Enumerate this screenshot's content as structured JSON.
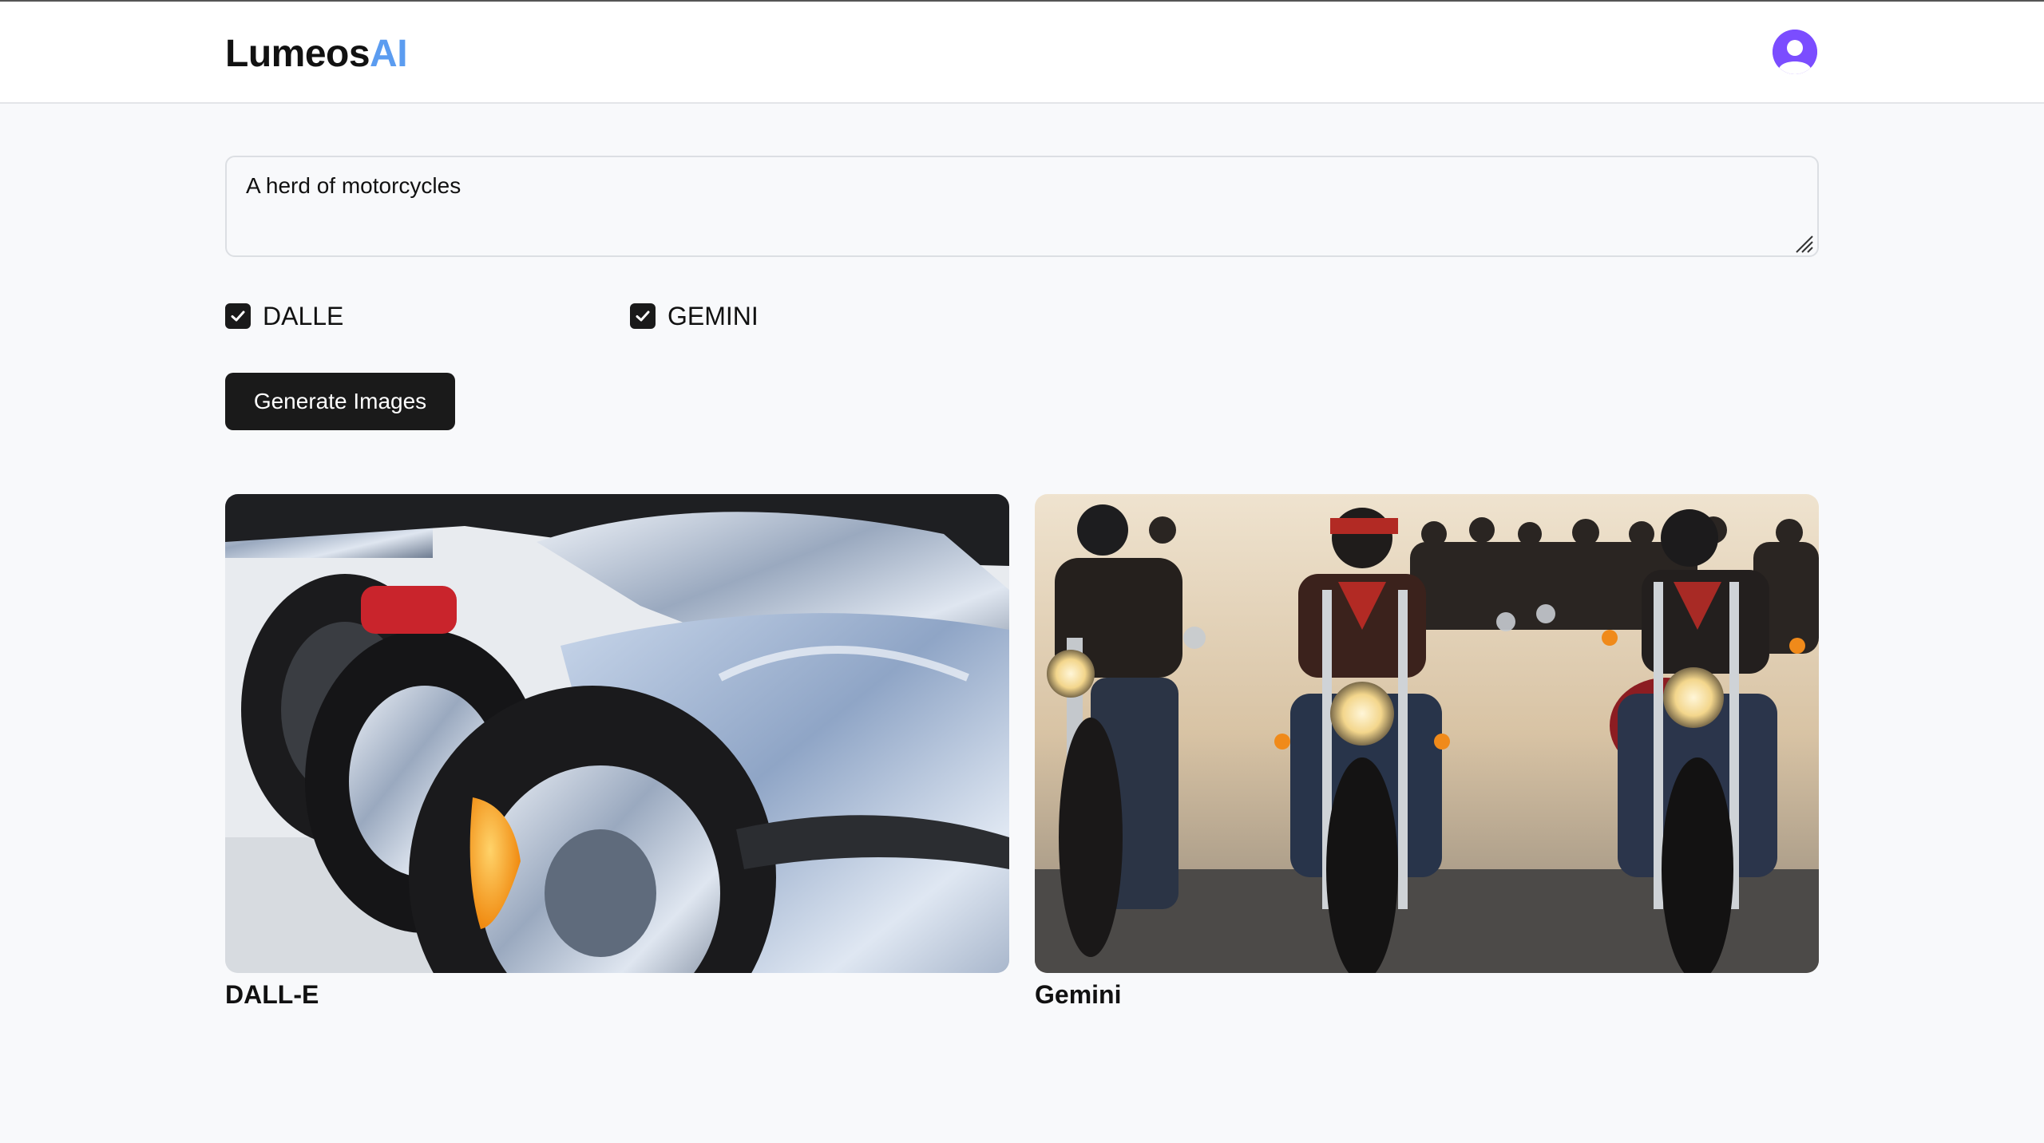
{
  "header": {
    "brand_main": "Lumeos",
    "brand_accent": "AI",
    "brand_accent_color": "#5b9cf0",
    "avatar_icon": "user-avatar-icon",
    "avatar_color": "#7b4dff"
  },
  "prompt": {
    "value": "A herd of motorcycles"
  },
  "models": [
    {
      "label": "DALLE",
      "checked": true
    },
    {
      "label": "GEMINI",
      "checked": true
    }
  ],
  "generate_button": {
    "label": "Generate Images"
  },
  "results": [
    {
      "caption": "DALL-E",
      "image": "closeup of chrome motorcycles parked in a row"
    },
    {
      "caption": "Gemini",
      "image": "group of bikers riding motorcycles on a dusty road"
    }
  ]
}
